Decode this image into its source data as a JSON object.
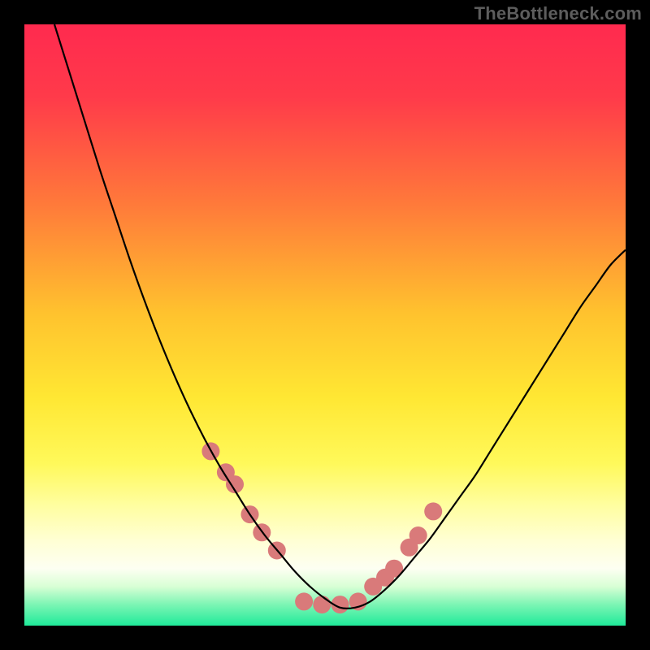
{
  "watermark": "TheBottleneck.com",
  "chart_data": {
    "type": "line",
    "title": "",
    "xlabel": "",
    "ylabel": "",
    "xlim": [
      0,
      100
    ],
    "ylim": [
      0,
      100
    ],
    "gradient_stops": [
      {
        "offset": 0.0,
        "color": "#ff2a4f"
      },
      {
        "offset": 0.12,
        "color": "#ff3a4a"
      },
      {
        "offset": 0.3,
        "color": "#ff7a3a"
      },
      {
        "offset": 0.48,
        "color": "#ffc22e"
      },
      {
        "offset": 0.62,
        "color": "#ffe733"
      },
      {
        "offset": 0.73,
        "color": "#fff95a"
      },
      {
        "offset": 0.8,
        "color": "#fffea0"
      },
      {
        "offset": 0.86,
        "color": "#ffffd5"
      },
      {
        "offset": 0.905,
        "color": "#fdfff2"
      },
      {
        "offset": 0.935,
        "color": "#d8ffd5"
      },
      {
        "offset": 0.965,
        "color": "#7cf5b4"
      },
      {
        "offset": 1.0,
        "color": "#1fea9a"
      }
    ],
    "series": [
      {
        "name": "curve",
        "x": [
          5.0,
          7.5,
          10.0,
          12.5,
          15.0,
          17.5,
          20.0,
          22.5,
          25.0,
          27.5,
          30.0,
          32.5,
          35.0,
          37.5,
          40.0,
          42.5,
          45.0,
          47.5,
          50.0,
          52.5,
          55.0,
          57.5,
          60.0,
          62.5,
          65.0,
          67.5,
          70.0,
          72.5,
          75.0,
          77.5,
          80.0,
          82.5,
          85.0,
          87.5,
          90.0,
          92.5,
          95.0,
          97.5,
          100.0
        ],
        "y": [
          100.0,
          92.0,
          84.0,
          76.0,
          68.5,
          61.0,
          54.0,
          47.5,
          41.5,
          36.0,
          31.0,
          26.5,
          22.5,
          18.5,
          15.0,
          12.0,
          9.0,
          6.5,
          4.5,
          3.0,
          3.0,
          4.0,
          6.0,
          8.5,
          11.5,
          14.5,
          18.0,
          21.5,
          25.0,
          29.0,
          33.0,
          37.0,
          41.0,
          45.0,
          49.0,
          53.0,
          56.5,
          60.0,
          62.5
        ]
      }
    ],
    "markers": {
      "name": "dots",
      "color": "#d97a7a",
      "radius_px": 11,
      "x": [
        31.0,
        33.5,
        35.0,
        37.5,
        39.5,
        42.0,
        46.5,
        49.5,
        52.5,
        55.5,
        58.0,
        60.0,
        61.5,
        64.0,
        65.5,
        68.0
      ],
      "y": [
        29.0,
        25.5,
        23.5,
        18.5,
        15.5,
        12.5,
        4.0,
        3.5,
        3.5,
        4.0,
        6.5,
        8.0,
        9.5,
        13.0,
        15.0,
        19.0
      ]
    }
  }
}
